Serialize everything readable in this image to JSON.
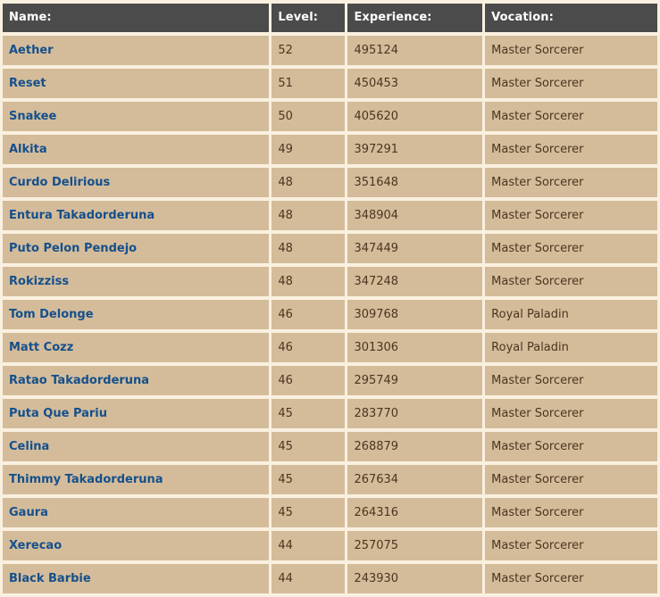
{
  "table": {
    "columns": [
      {
        "key": "name",
        "label": "Name:"
      },
      {
        "key": "level",
        "label": "Level:"
      },
      {
        "key": "experience",
        "label": "Experience:"
      },
      {
        "key": "vocation",
        "label": "Vocation:"
      }
    ],
    "rows": [
      {
        "name": "Aether",
        "level": "52",
        "experience": "495124",
        "vocation": "Master Sorcerer"
      },
      {
        "name": "Reset",
        "level": "51",
        "experience": "450453",
        "vocation": "Master Sorcerer"
      },
      {
        "name": "Snakee",
        "level": "50",
        "experience": "405620",
        "vocation": "Master Sorcerer"
      },
      {
        "name": "Alkita",
        "level": "49",
        "experience": "397291",
        "vocation": "Master Sorcerer"
      },
      {
        "name": "Curdo Delirious",
        "level": "48",
        "experience": "351648",
        "vocation": "Master Sorcerer"
      },
      {
        "name": "Entura Takadorderuna",
        "level": "48",
        "experience": "348904",
        "vocation": "Master Sorcerer"
      },
      {
        "name": "Puto Pelon Pendejo",
        "level": "48",
        "experience": "347449",
        "vocation": "Master Sorcerer"
      },
      {
        "name": "Rokizziss",
        "level": "48",
        "experience": "347248",
        "vocation": "Master Sorcerer"
      },
      {
        "name": "Tom Delonge",
        "level": "46",
        "experience": "309768",
        "vocation": "Royal Paladin"
      },
      {
        "name": "Matt Cozz",
        "level": "46",
        "experience": "301306",
        "vocation": "Royal Paladin"
      },
      {
        "name": "Ratao Takadorderuna",
        "level": "46",
        "experience": "295749",
        "vocation": "Master Sorcerer"
      },
      {
        "name": "Puta Que Pariu",
        "level": "45",
        "experience": "283770",
        "vocation": "Master Sorcerer"
      },
      {
        "name": "Celina",
        "level": "45",
        "experience": "268879",
        "vocation": "Master Sorcerer"
      },
      {
        "name": "Thimmy Takadorderuna",
        "level": "45",
        "experience": "267634",
        "vocation": "Master Sorcerer"
      },
      {
        "name": "Gaura",
        "level": "45",
        "experience": "264316",
        "vocation": "Master Sorcerer"
      },
      {
        "name": "Xerecao",
        "level": "44",
        "experience": "257075",
        "vocation": "Master Sorcerer"
      },
      {
        "name": "Black Barbie",
        "level": "44",
        "experience": "243930",
        "vocation": "Master Sorcerer"
      }
    ]
  },
  "colors": {
    "header_background": "#4b4b4b",
    "header_text": "#ffffff",
    "row_background": "#d4bc9a",
    "page_background": "#faf0e0",
    "link_text": "#15508c",
    "body_text": "#4a3520"
  }
}
